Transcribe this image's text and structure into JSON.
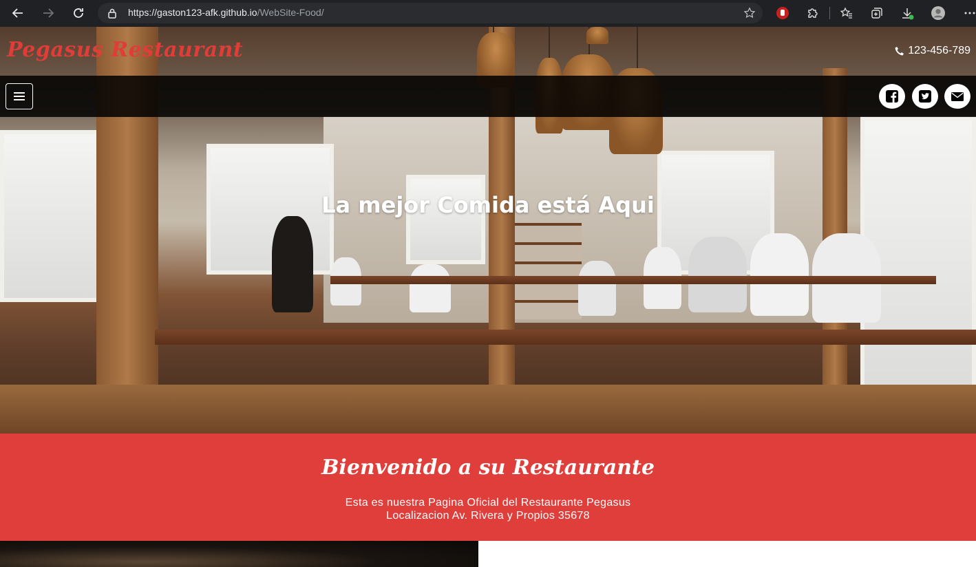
{
  "browser": {
    "url_host": "https://gaston123-afk.github.io",
    "url_path": "/WebSite-Food/"
  },
  "site": {
    "logo": "Pegasus Restaurant",
    "phone": "123-456-789",
    "hero_title": "La mejor Comida está Aqui",
    "social": [
      "facebook-icon",
      "twitter-icon",
      "email-icon"
    ]
  },
  "welcome": {
    "title": "Bienvenido a su Restaurante",
    "line1": "Esta es nuestra Pagina Oficial del Restaurante Pegasus",
    "line2": "Localizacion Av. Rivera y Propios 35678"
  },
  "colors": {
    "brand_red": "#e03e3b",
    "navbar": "#000000",
    "chrome": "#202124"
  }
}
